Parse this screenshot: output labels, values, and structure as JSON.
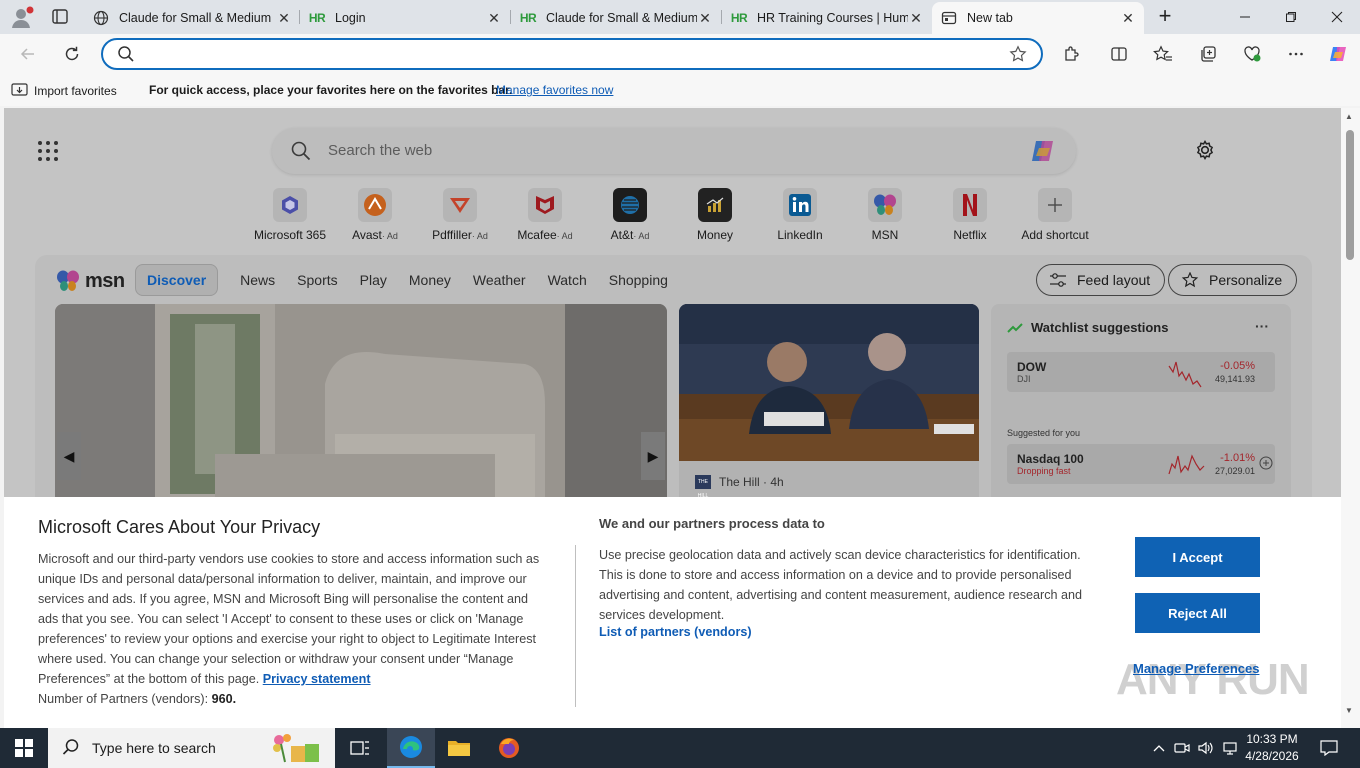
{
  "browser": {
    "tabs": [
      {
        "title": "Claude for Small & Medium",
        "icon": "globe-icon",
        "active": false
      },
      {
        "title": "Login",
        "icon": "hr-logo",
        "active": false
      },
      {
        "title": "Claude for Small & Medium",
        "icon": "hr-logo",
        "active": false
      },
      {
        "title": "HR Training Courses | Huma",
        "icon": "hr-logo",
        "active": false
      },
      {
        "title": "New tab",
        "icon": "newtab-icon",
        "active": true
      }
    ],
    "hr_logo_text": "HR",
    "address": {
      "value": "",
      "placeholder": ""
    },
    "favorites_bar": {
      "import_label": "Import favorites",
      "message": "For quick access, place your favorites here on the favorites bar.",
      "manage_link": "Manage favorites now"
    }
  },
  "ntp": {
    "search_placeholder": "Search the web",
    "shortcuts": [
      {
        "label": "Microsoft 365",
        "ad": ""
      },
      {
        "label": "Avast",
        "ad": "· Ad"
      },
      {
        "label": "Pdffiller",
        "ad": "· Ad"
      },
      {
        "label": "Mcafee",
        "ad": "· Ad"
      },
      {
        "label": "At&t",
        "ad": "· Ad"
      },
      {
        "label": "Money",
        "ad": ""
      },
      {
        "label": "LinkedIn",
        "ad": ""
      },
      {
        "label": "MSN",
        "ad": ""
      },
      {
        "label": "Netflix",
        "ad": ""
      },
      {
        "label": "Add shortcut",
        "ad": ""
      }
    ],
    "feed": {
      "logo_text": "msn",
      "nav": [
        "Discover",
        "News",
        "Sports",
        "Play",
        "Money",
        "Weather",
        "Watch",
        "Shopping"
      ],
      "feed_layout_label": "Feed layout",
      "personalize_label": "Personalize",
      "news_source": "The Hill",
      "news_time": "· 4h",
      "news_source_logo": "THE HILL",
      "watchlist": {
        "title": "Watchlist suggestions",
        "more": "···",
        "suggested_label": "Suggested for you",
        "stocks": [
          {
            "symbol": "DOW",
            "sub": "DJI",
            "change": "-0.05%",
            "price": "49,141.93"
          },
          {
            "symbol": "Nasdaq 100",
            "sub": "Dropping fast",
            "change": "-1.01%",
            "price": "27,029.01"
          }
        ]
      }
    }
  },
  "privacy": {
    "title": "Microsoft Cares About Your Privacy",
    "body": "Microsoft and our third-party vendors use cookies to store and access information such as unique IDs and personal data/personal information to deliver, maintain, and improve our services and ads. If you agree, MSN and Microsoft Bing will personalise the content and ads that you see. You can select 'I Accept' to consent to these uses or click on 'Manage preferences' to review your options and exercise your right to object to Legitimate Interest where used. You can change your selection or withdraw your consent under “Manage Preferences” at the bottom of this page.",
    "privacy_link": "Privacy statement",
    "partners_count_label": "Number of Partners (vendors):",
    "partners_count": "960.",
    "right_title": "We and our partners process data to",
    "right_body": "Use precise geolocation data and actively scan device characteristics for identification. This is done to store and access information on a device and to provide personalised advertising and content, advertising and content measurement, audience research and services development.",
    "partners_link": "List of partners (vendors)",
    "accept_label": "I Accept",
    "reject_label": "Reject All",
    "manage_label": "Manage Preferences",
    "watermark": "ANY RUN"
  },
  "taskbar": {
    "search_placeholder": "Type here to search",
    "time": "10:33 PM",
    "date": "4/28/2026"
  },
  "colors": {
    "accent": "#0f62b4",
    "link": "#0f5cb5",
    "taskbar": "#1f2a36",
    "negative": "#a4262c",
    "positive": "#2e9a3c"
  }
}
